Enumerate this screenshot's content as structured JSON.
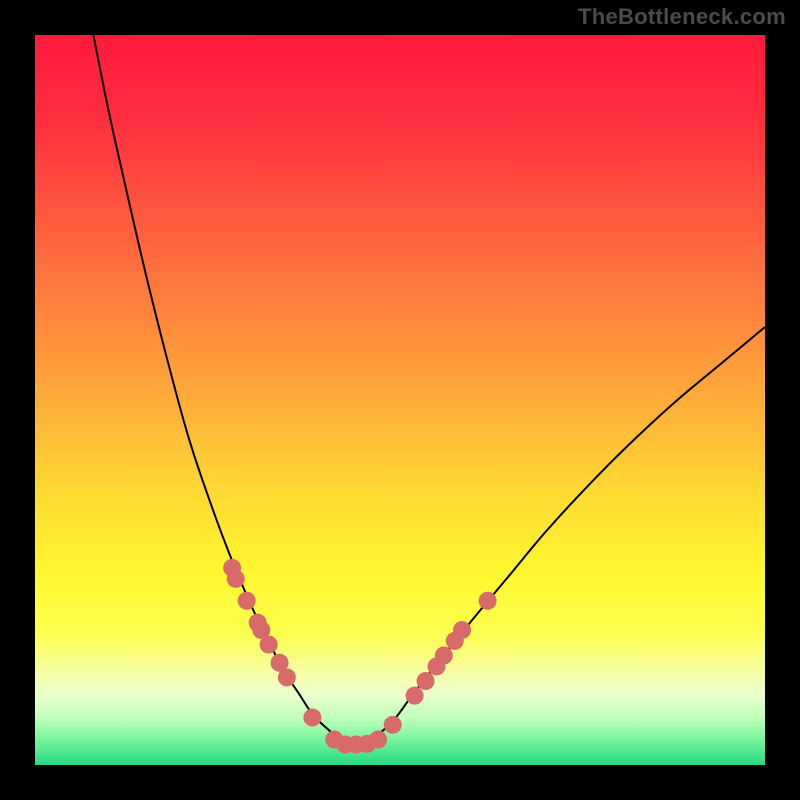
{
  "watermark_text": "TheBottleneck.com",
  "colors": {
    "frame": "#000000",
    "curve": "#000000",
    "marker_fill": "#d96a6a",
    "marker_stroke": "#c95a5a",
    "watermark": "#4b4b4b",
    "gradient_stops": [
      {
        "offset": 0.0,
        "color": "#ff1a3c"
      },
      {
        "offset": 0.12,
        "color": "#ff2f3f"
      },
      {
        "offset": 0.3,
        "color": "#ff6a3e"
      },
      {
        "offset": 0.48,
        "color": "#ffa53a"
      },
      {
        "offset": 0.62,
        "color": "#ffd833"
      },
      {
        "offset": 0.74,
        "color": "#fff82f"
      },
      {
        "offset": 0.82,
        "color": "#fcff4e"
      },
      {
        "offset": 0.875,
        "color": "#f6ffa8"
      },
      {
        "offset": 0.905,
        "color": "#e9ffce"
      },
      {
        "offset": 0.935,
        "color": "#c2ffba"
      },
      {
        "offset": 0.965,
        "color": "#77f59a"
      },
      {
        "offset": 1.0,
        "color": "#25d884"
      }
    ]
  },
  "chart_data": {
    "type": "line",
    "title": "",
    "xlabel": "",
    "ylabel": "",
    "xlim": [
      0,
      100
    ],
    "ylim": [
      0,
      100
    ],
    "grid": false,
    "legend": false,
    "series": [
      {
        "name": "bottleneck-curve",
        "x": [
          8,
          10,
          12,
          15,
          18,
          21,
          24,
          27,
          30,
          32,
          34,
          36,
          38,
          40,
          42,
          44,
          46,
          49,
          52,
          56,
          60,
          65,
          70,
          76,
          82,
          88,
          94,
          100
        ],
        "y": [
          100,
          90,
          81,
          68,
          56,
          45,
          36,
          28,
          21,
          17,
          13,
          10,
          7,
          5,
          3.5,
          2.8,
          3.5,
          6,
          10,
          15,
          20,
          26,
          32,
          38.5,
          44.5,
          50,
          55,
          60
        ]
      }
    ],
    "markers": [
      {
        "x": 27.0,
        "y": 27.0
      },
      {
        "x": 27.5,
        "y": 25.5
      },
      {
        "x": 29.0,
        "y": 22.5
      },
      {
        "x": 30.5,
        "y": 19.5
      },
      {
        "x": 31.0,
        "y": 18.5
      },
      {
        "x": 32.0,
        "y": 16.5
      },
      {
        "x": 33.5,
        "y": 14.0
      },
      {
        "x": 34.5,
        "y": 12.0
      },
      {
        "x": 38.0,
        "y": 6.5
      },
      {
        "x": 41.0,
        "y": 3.5
      },
      {
        "x": 42.5,
        "y": 2.8
      },
      {
        "x": 44.0,
        "y": 2.8
      },
      {
        "x": 45.5,
        "y": 2.9
      },
      {
        "x": 47.0,
        "y": 3.5
      },
      {
        "x": 49.0,
        "y": 5.5
      },
      {
        "x": 52.0,
        "y": 9.5
      },
      {
        "x": 53.5,
        "y": 11.5
      },
      {
        "x": 55.0,
        "y": 13.5
      },
      {
        "x": 56.0,
        "y": 15.0
      },
      {
        "x": 57.5,
        "y": 17.0
      },
      {
        "x": 58.5,
        "y": 18.5
      },
      {
        "x": 62.0,
        "y": 22.5
      }
    ]
  }
}
